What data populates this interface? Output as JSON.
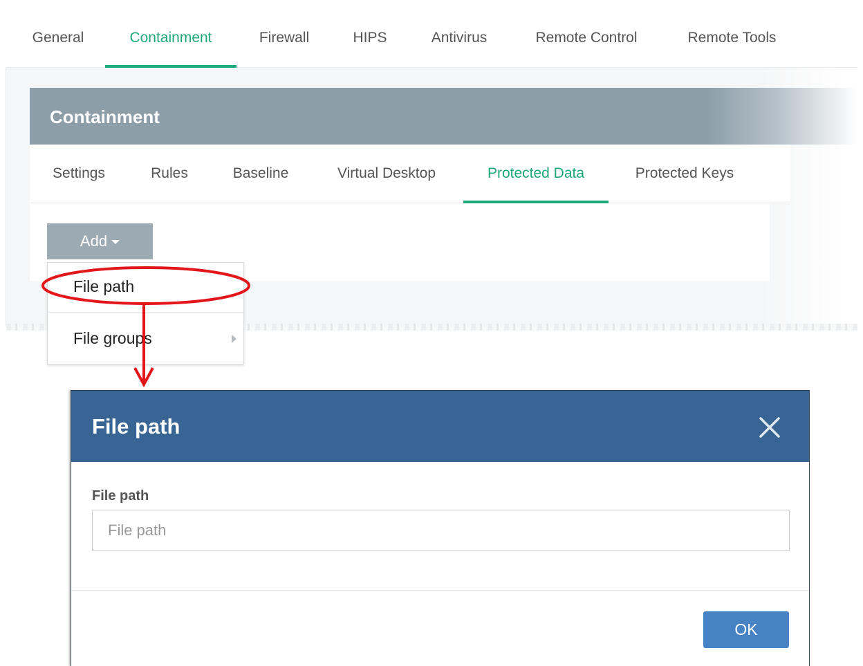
{
  "main_tabs": [
    {
      "label": "General",
      "active": false
    },
    {
      "label": "Containment",
      "active": true
    },
    {
      "label": "Firewall",
      "active": false
    },
    {
      "label": "HIPS",
      "active": false
    },
    {
      "label": "Antivirus",
      "active": false
    },
    {
      "label": "Remote Control",
      "active": false
    },
    {
      "label": "Remote Tools",
      "active": false
    }
  ],
  "section": {
    "title": "Containment"
  },
  "sub_tabs": [
    {
      "label": "Settings",
      "active": false
    },
    {
      "label": "Rules",
      "active": false
    },
    {
      "label": "Baseline",
      "active": false
    },
    {
      "label": "Virtual Desktop",
      "active": false
    },
    {
      "label": "Protected Data",
      "active": true
    },
    {
      "label": "Protected Keys",
      "active": false
    }
  ],
  "add_button": {
    "label": "Add"
  },
  "dropdown": {
    "items": [
      {
        "label": "File path",
        "highlighted": true
      },
      {
        "label": "File groups",
        "has_submenu": true
      }
    ]
  },
  "annotation": {
    "color": "#e3161c"
  },
  "dialog": {
    "title": "File path",
    "field_label": "File path",
    "field_value": "",
    "field_placeholder": "File path",
    "ok_label": "OK"
  },
  "colors": {
    "accent_green": "#1fa67a",
    "header_gray": "#8d9ea9",
    "dialog_blue": "#386594",
    "ok_blue": "#4782c4"
  },
  "icons": {
    "close": "close-icon",
    "caret": "caret-down-icon",
    "submenu": "caret-right-icon"
  }
}
